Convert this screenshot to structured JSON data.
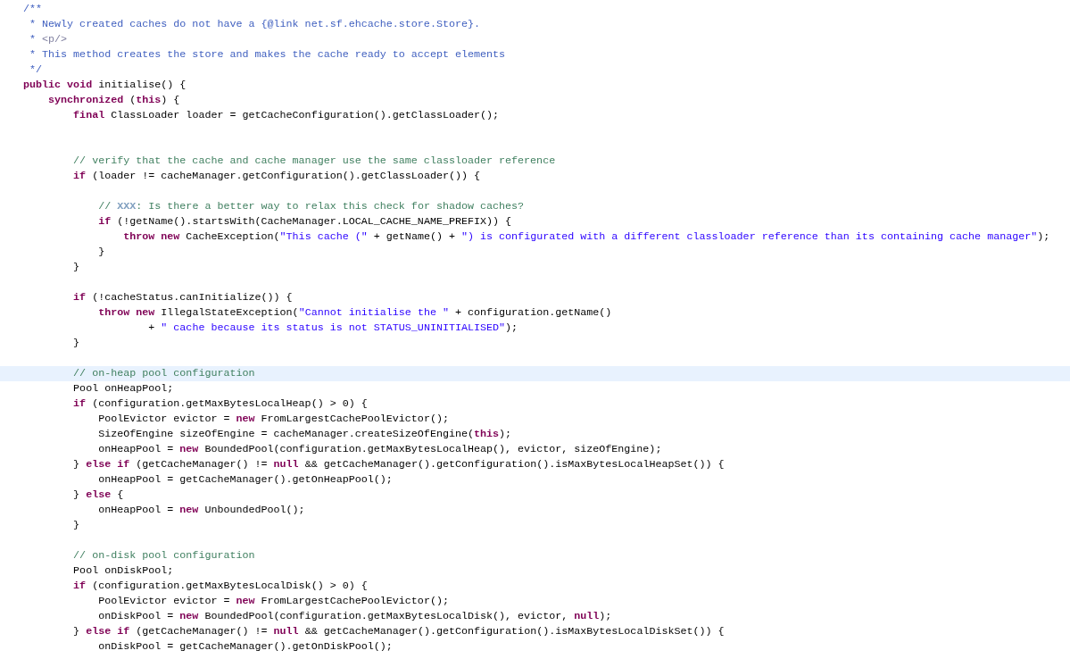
{
  "editor": {
    "lines": [
      {
        "kind": "code",
        "current": false,
        "tokens": [
          {
            "kind": "javadoc",
            "text": "/**"
          }
        ]
      },
      {
        "kind": "code",
        "current": false,
        "tokens": [
          {
            "kind": "javadoc",
            "text": " * Newly created caches do not have a {@link net.sf.ehcache.store.Store}."
          }
        ]
      },
      {
        "kind": "code",
        "current": false,
        "tokens": [
          {
            "kind": "javadoc",
            "text": " * "
          },
          {
            "kind": "javadoc-tag",
            "text": "<p/>"
          }
        ]
      },
      {
        "kind": "code",
        "current": false,
        "tokens": [
          {
            "kind": "javadoc",
            "text": " * This method creates the store and makes the cache ready to accept elements"
          }
        ]
      },
      {
        "kind": "code",
        "current": false,
        "tokens": [
          {
            "kind": "javadoc",
            "text": " */"
          }
        ]
      },
      {
        "kind": "code",
        "current": false,
        "tokens": [
          {
            "kind": "keyword",
            "text": "public"
          },
          {
            "kind": "keyword",
            "text": " void"
          },
          {
            "kind": "plain",
            "text": " initialise() {"
          }
        ]
      },
      {
        "kind": "code",
        "current": false,
        "tokens": [
          {
            "kind": "keyword",
            "text": "    synchronized"
          },
          {
            "kind": "plain",
            "text": " ("
          },
          {
            "kind": "keyword",
            "text": "this"
          },
          {
            "kind": "plain",
            "text": ") {"
          }
        ]
      },
      {
        "kind": "code",
        "current": false,
        "tokens": [
          {
            "kind": "keyword",
            "text": "        final"
          },
          {
            "kind": "plain",
            "text": " ClassLoader loader = getCacheConfiguration().getClassLoader();"
          }
        ]
      },
      {
        "kind": "blank",
        "current": false
      },
      {
        "kind": "blank",
        "current": false
      },
      {
        "kind": "code",
        "current": false,
        "tokens": [
          {
            "kind": "comment",
            "text": "        // verify that the cache and cache manager use the same classloader reference"
          }
        ]
      },
      {
        "kind": "code",
        "current": false,
        "tokens": [
          {
            "kind": "keyword",
            "text": "        if"
          },
          {
            "kind": "plain",
            "text": " (loader != cacheManager.getConfiguration().getClassLoader()) {"
          }
        ]
      },
      {
        "kind": "blank",
        "current": false
      },
      {
        "kind": "code",
        "current": false,
        "tokens": [
          {
            "kind": "comment",
            "text": "            // "
          },
          {
            "kind": "task-tag",
            "text": "XXX"
          },
          {
            "kind": "comment",
            "text": ": Is there a better way to relax this check for shadow caches?"
          }
        ]
      },
      {
        "kind": "code",
        "current": false,
        "tokens": [
          {
            "kind": "keyword",
            "text": "            if"
          },
          {
            "kind": "plain",
            "text": " (!getName().startsWith(CacheManager.LOCAL_CACHE_NAME_PREFIX)) {"
          }
        ]
      },
      {
        "kind": "code",
        "current": false,
        "tokens": [
          {
            "kind": "keyword",
            "text": "                throw"
          },
          {
            "kind": "keyword",
            "text": " new"
          },
          {
            "kind": "plain",
            "text": " CacheException("
          },
          {
            "kind": "string",
            "text": "\"This cache (\""
          },
          {
            "kind": "plain",
            "text": " + getName() + "
          },
          {
            "kind": "string",
            "text": "\") is configurated with a different classloader reference than its containing cache manager\""
          },
          {
            "kind": "plain",
            "text": ");"
          }
        ]
      },
      {
        "kind": "code",
        "current": false,
        "tokens": [
          {
            "kind": "plain",
            "text": "            }"
          }
        ]
      },
      {
        "kind": "code",
        "current": false,
        "tokens": [
          {
            "kind": "plain",
            "text": "        }"
          }
        ]
      },
      {
        "kind": "blank",
        "current": false
      },
      {
        "kind": "code",
        "current": false,
        "tokens": [
          {
            "kind": "keyword",
            "text": "        if"
          },
          {
            "kind": "plain",
            "text": " (!cacheStatus.canInitialize()) {"
          }
        ]
      },
      {
        "kind": "code",
        "current": false,
        "tokens": [
          {
            "kind": "keyword",
            "text": "            throw"
          },
          {
            "kind": "keyword",
            "text": " new"
          },
          {
            "kind": "plain",
            "text": " IllegalStateException("
          },
          {
            "kind": "string",
            "text": "\"Cannot initialise the \""
          },
          {
            "kind": "plain",
            "text": " + configuration.getName()"
          }
        ]
      },
      {
        "kind": "code",
        "current": false,
        "tokens": [
          {
            "kind": "plain",
            "text": "                    +"
          },
          {
            "kind": "string",
            "text": " \" cache because its status is not STATUS_UNINITIALISED\""
          },
          {
            "kind": "plain",
            "text": ");"
          }
        ]
      },
      {
        "kind": "code",
        "current": false,
        "tokens": [
          {
            "kind": "plain",
            "text": "        }"
          }
        ]
      },
      {
        "kind": "blank",
        "current": false
      },
      {
        "kind": "code",
        "current": true,
        "tokens": [
          {
            "kind": "comment",
            "text": "        // on-heap pool configuration"
          }
        ]
      },
      {
        "kind": "code",
        "current": false,
        "tokens": [
          {
            "kind": "plain",
            "text": "        Pool onHeapPool;"
          }
        ]
      },
      {
        "kind": "code",
        "current": false,
        "tokens": [
          {
            "kind": "keyword",
            "text": "        if"
          },
          {
            "kind": "plain",
            "text": " (configuration.getMaxBytesLocalHeap() > 0) {"
          }
        ]
      },
      {
        "kind": "code",
        "current": false,
        "tokens": [
          {
            "kind": "plain",
            "text": "            PoolEvictor evictor ="
          },
          {
            "kind": "keyword",
            "text": " new"
          },
          {
            "kind": "plain",
            "text": " FromLargestCachePoolEvictor();"
          }
        ]
      },
      {
        "kind": "code",
        "current": false,
        "tokens": [
          {
            "kind": "plain",
            "text": "            SizeOfEngine sizeOfEngine = cacheManager.createSizeOfEngine("
          },
          {
            "kind": "keyword",
            "text": "this"
          },
          {
            "kind": "plain",
            "text": ");"
          }
        ]
      },
      {
        "kind": "code",
        "current": false,
        "tokens": [
          {
            "kind": "plain",
            "text": "            onHeapPool ="
          },
          {
            "kind": "keyword",
            "text": " new"
          },
          {
            "kind": "plain",
            "text": " BoundedPool(configuration.getMaxBytesLocalHeap(), evictor, sizeOfEngine);"
          }
        ]
      },
      {
        "kind": "code",
        "current": false,
        "tokens": [
          {
            "kind": "plain",
            "text": "        }"
          },
          {
            "kind": "keyword",
            "text": " else"
          },
          {
            "kind": "keyword",
            "text": " if"
          },
          {
            "kind": "plain",
            "text": " (getCacheManager() != "
          },
          {
            "kind": "keyword",
            "text": "null"
          },
          {
            "kind": "plain",
            "text": " && getCacheManager().getConfiguration().isMaxBytesLocalHeapSet()) {"
          }
        ]
      },
      {
        "kind": "code",
        "current": false,
        "tokens": [
          {
            "kind": "plain",
            "text": "            onHeapPool = getCacheManager().getOnHeapPool();"
          }
        ]
      },
      {
        "kind": "code",
        "current": false,
        "tokens": [
          {
            "kind": "plain",
            "text": "        }"
          },
          {
            "kind": "keyword",
            "text": " else"
          },
          {
            "kind": "plain",
            "text": " {"
          }
        ]
      },
      {
        "kind": "code",
        "current": false,
        "tokens": [
          {
            "kind": "plain",
            "text": "            onHeapPool ="
          },
          {
            "kind": "keyword",
            "text": " new"
          },
          {
            "kind": "plain",
            "text": " UnboundedPool();"
          }
        ]
      },
      {
        "kind": "code",
        "current": false,
        "tokens": [
          {
            "kind": "plain",
            "text": "        }"
          }
        ]
      },
      {
        "kind": "blank",
        "current": false
      },
      {
        "kind": "code",
        "current": false,
        "tokens": [
          {
            "kind": "comment",
            "text": "        // on-disk pool configuration"
          }
        ]
      },
      {
        "kind": "code",
        "current": false,
        "tokens": [
          {
            "kind": "plain",
            "text": "        Pool onDiskPool;"
          }
        ]
      },
      {
        "kind": "code",
        "current": false,
        "tokens": [
          {
            "kind": "keyword",
            "text": "        if"
          },
          {
            "kind": "plain",
            "text": " (configuration.getMaxBytesLocalDisk() > 0) {"
          }
        ]
      },
      {
        "kind": "code",
        "current": false,
        "tokens": [
          {
            "kind": "plain",
            "text": "            PoolEvictor evictor ="
          },
          {
            "kind": "keyword",
            "text": " new"
          },
          {
            "kind": "plain",
            "text": " FromLargestCachePoolEvictor();"
          }
        ]
      },
      {
        "kind": "code",
        "current": false,
        "tokens": [
          {
            "kind": "plain",
            "text": "            onDiskPool ="
          },
          {
            "kind": "keyword",
            "text": " new"
          },
          {
            "kind": "plain",
            "text": " BoundedPool(configuration.getMaxBytesLocalDisk(), evictor, "
          },
          {
            "kind": "keyword",
            "text": "null"
          },
          {
            "kind": "plain",
            "text": ");"
          }
        ]
      },
      {
        "kind": "code",
        "current": false,
        "tokens": [
          {
            "kind": "plain",
            "text": "        }"
          },
          {
            "kind": "keyword",
            "text": " else"
          },
          {
            "kind": "keyword",
            "text": " if"
          },
          {
            "kind": "plain",
            "text": " (getCacheManager() != "
          },
          {
            "kind": "keyword",
            "text": "null"
          },
          {
            "kind": "plain",
            "text": " && getCacheManager().getConfiguration().isMaxBytesLocalDiskSet()) {"
          }
        ]
      },
      {
        "kind": "code",
        "current": false,
        "tokens": [
          {
            "kind": "plain",
            "text": "            onDiskPool = getCacheManager().getOnDiskPool();"
          }
        ]
      }
    ]
  }
}
